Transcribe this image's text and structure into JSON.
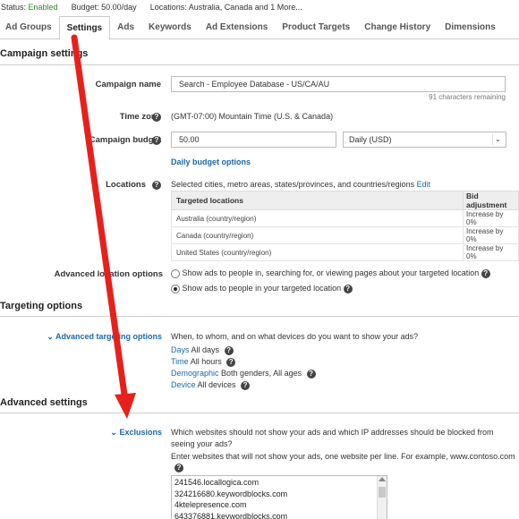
{
  "status": {
    "status_label": "Status:",
    "status_value": "Enabled",
    "budget": "Budget: 50.00/day",
    "locations": "Locations: Australia, Canada and 1 More..."
  },
  "tabs": [
    "Ad Groups",
    "Settings",
    "Ads",
    "Keywords",
    "Ad Extensions",
    "Product Targets",
    "Change History",
    "Dimensions"
  ],
  "campaign_settings": {
    "title": "Campaign settings",
    "campaign_name_label": "Campaign name",
    "campaign_name_value": "Search - Employee Database - US/CA/AU",
    "chars_remaining": "91 characters remaining",
    "time_zone_label": "Time zone",
    "time_zone_value": "(GMT-07:00) Mountain Time (U.S. & Canada)",
    "budget_label": "Campaign budget",
    "budget_value": "50.00",
    "budget_type": "Daily (USD)",
    "budget_options_link": "Daily budget options",
    "locations_label": "Locations",
    "locations_desc": "Selected cities, metro areas, states/provinces, and countries/regions",
    "locations_edit": "Edit",
    "locations_table": {
      "headers": [
        "Targeted locations",
        "Bid adjustment"
      ],
      "rows": [
        [
          "Australia (country/region)",
          "Increase by 0%"
        ],
        [
          "Canada (country/region)",
          "Increase by 0%"
        ],
        [
          "United States (country/region)",
          "Increase by 0%"
        ]
      ]
    },
    "advanced_location_label": "Advanced location options",
    "location_option_1": "Show ads to people in, searching for, or viewing pages about your targeted location",
    "location_option_2": "Show ads to people in your targeted location",
    "selected_location_option": 2
  },
  "targeting": {
    "title": "Targeting options",
    "advanced_label": "Advanced targeting options",
    "description": "When, to whom, and on what devices do you want to show your ads?",
    "items": [
      {
        "link": "Days",
        "value": "All days"
      },
      {
        "link": "Time",
        "value": "All hours"
      },
      {
        "link": "Demographic",
        "value": "Both genders, All ages"
      },
      {
        "link": "Device",
        "value": "All devices"
      }
    ]
  },
  "advanced": {
    "title": "Advanced settings",
    "exclusions_label": "Exclusions",
    "exclusions_desc_1": "Which websites should not show your ads and which IP addresses should be blocked from",
    "exclusions_desc_2": "seeing your ads?",
    "exclusions_hint": "Enter websites that will not show your ads, one website per line. For example, www.contoso.com",
    "excluded_sites": [
      "241546.locallogica.com",
      "324216680.keywordblocks.com",
      "4ktelepresence.com",
      "643376881.keywordblocks.com"
    ]
  },
  "colors": {
    "enabled": "#2a8a2a",
    "link": "#1a6aaa",
    "annotation_arrow": "#e8201a"
  },
  "icons": [
    "help-icon",
    "chevron-down-icon",
    "radio-button",
    "annotation-arrow"
  ]
}
